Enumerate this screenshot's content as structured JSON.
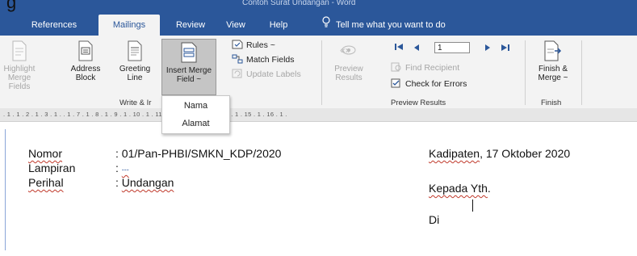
{
  "top": {
    "cut_label": "g",
    "title": "Contoh Surat Undangan  -  Word"
  },
  "tabs": [
    "References",
    "Mailings",
    "Review",
    "View",
    "Help"
  ],
  "tell_me": "Tell me what you want to do",
  "ribbon": {
    "highlight_merge_fields": [
      "Highlight",
      "Merge Fields"
    ],
    "address_block": [
      "Address",
      "Block"
    ],
    "greeting_line": [
      "Greeting",
      "Line"
    ],
    "insert_merge_field": [
      "Insert Merge",
      "Field ~"
    ],
    "rules": "Rules ~",
    "match_fields": "Match Fields",
    "update_labels": "Update Labels",
    "write_insert_group": "Write & Ir",
    "preview_results_btn": [
      "Preview",
      "Results"
    ],
    "record_number": "1",
    "find_recipient": "Find Recipient",
    "check_for_errors": "Check for Errors",
    "preview_results_group": "Preview Results",
    "finish_merge": [
      "Finish &",
      "Merge ~"
    ],
    "finish_group": "Finish"
  },
  "dropdown": [
    "Nama",
    "Alamat"
  ],
  "ruler": ". 1 . 1 . 2 . 1 . 3 . 1 .                     . 1 . 7 . 1 . 8 . 1 . 9 . 1 . 10 . 1 . 11 . 1 . 12 . 1 . 13 . 1 . 14 . 1 . 15 . 1 . 16 . 1 .",
  "letter": {
    "nomor_label": "Nomor",
    "nomor_value": ": 01/Pan-PHBI/SMKN_KDP/2020",
    "lampiran_label": "Lampiran",
    "lampiran_value": ": ",
    "lampiran_dash": "---",
    "perihal_label": "Perihal",
    "perihal_sep": ": ",
    "perihal_value": "Undangan",
    "place": "Kadipaten",
    "date": ", 17 Oktober 2020",
    "kepada": "Kepada Yth",
    "kepada_dot": ".",
    "di": "Di"
  },
  "colors": {
    "word_blue": "#2b579a",
    "ribbon_bg": "#f3f3f3",
    "disabled": "#a6a6a6"
  }
}
